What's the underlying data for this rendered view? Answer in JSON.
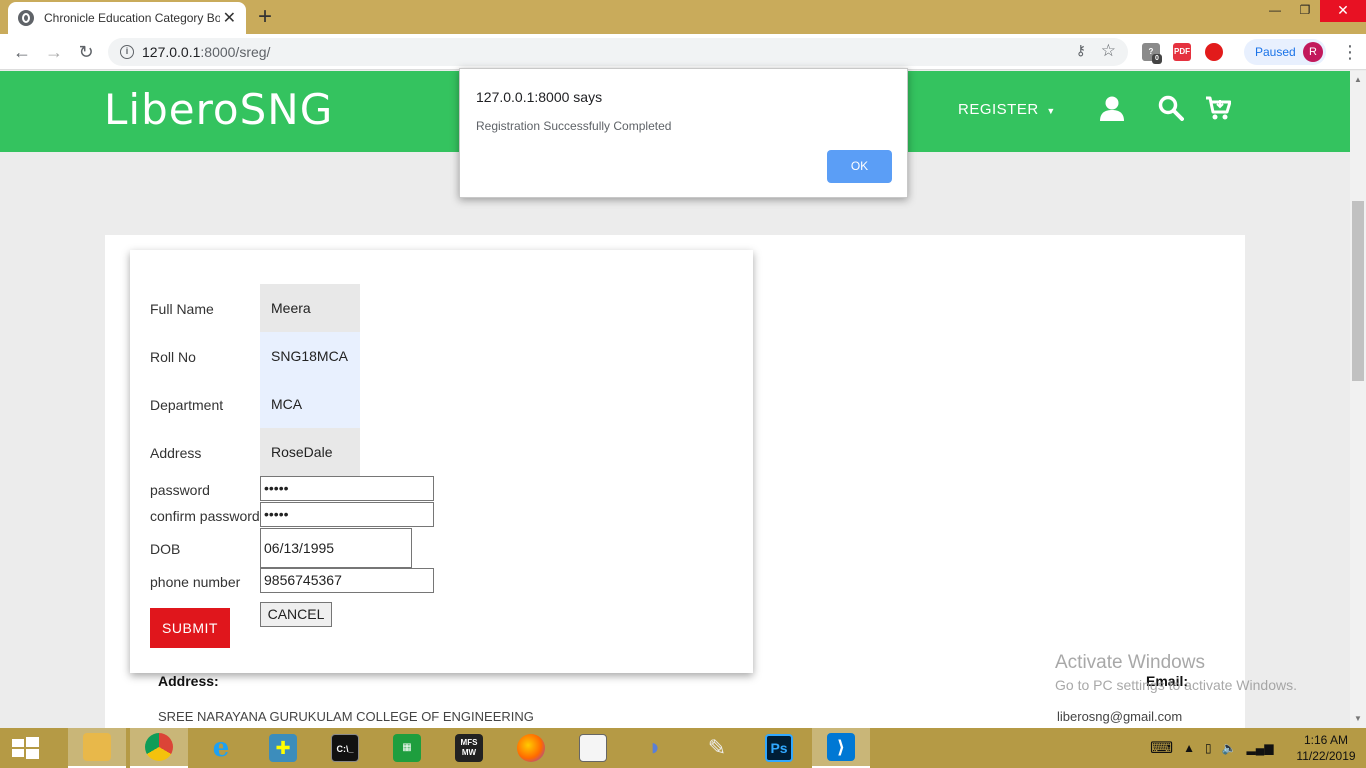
{
  "browser": {
    "tab_title": "Chronicle Education Category Bo",
    "url_host": "127.0.0.1",
    "url_path": ":8000/sreg/",
    "profile_status": "Paused",
    "profile_initial": "R",
    "ext_badge": "0",
    "ext_pdf_label": "PDF"
  },
  "site": {
    "logo": "LiberoSNG",
    "nav_register": "REGISTER"
  },
  "form": {
    "fullname_label": "Full Name",
    "fullname_value": "Meera",
    "rollno_label": "Roll No",
    "rollno_value": "SNG18MCA",
    "dept_label": "Department",
    "dept_value": "MCA",
    "address_label": "Address",
    "address_value": "RoseDale",
    "password_label": "password",
    "password_value": "•••••",
    "confirm_label": "confirm password",
    "confirm_value": "•••••",
    "dob_label": "DOB",
    "dob_value": "06/13/1995",
    "phone_label": "phone number",
    "phone_value": "9856745367",
    "submit_label": "SUBMIT",
    "cancel_label": "CANCEL"
  },
  "footer": {
    "address_title": "Address:",
    "address_text": "SREE NARAYANA GURUKULAM COLLEGE OF ENGINEERING",
    "email_title": "Email:",
    "email_text": "liberosng@gmail.com"
  },
  "watermark": {
    "title": "Activate Windows",
    "subtitle": "Go to PC settings to activate Windows."
  },
  "alert": {
    "title": "127.0.0.1:8000 says",
    "message": "Registration Successfully Completed",
    "ok_label": "OK"
  },
  "taskbar": {
    "time": "1:16 AM",
    "date": "11/22/2019",
    "mfs_label": "MFS MW",
    "ps_label": "Ps"
  }
}
